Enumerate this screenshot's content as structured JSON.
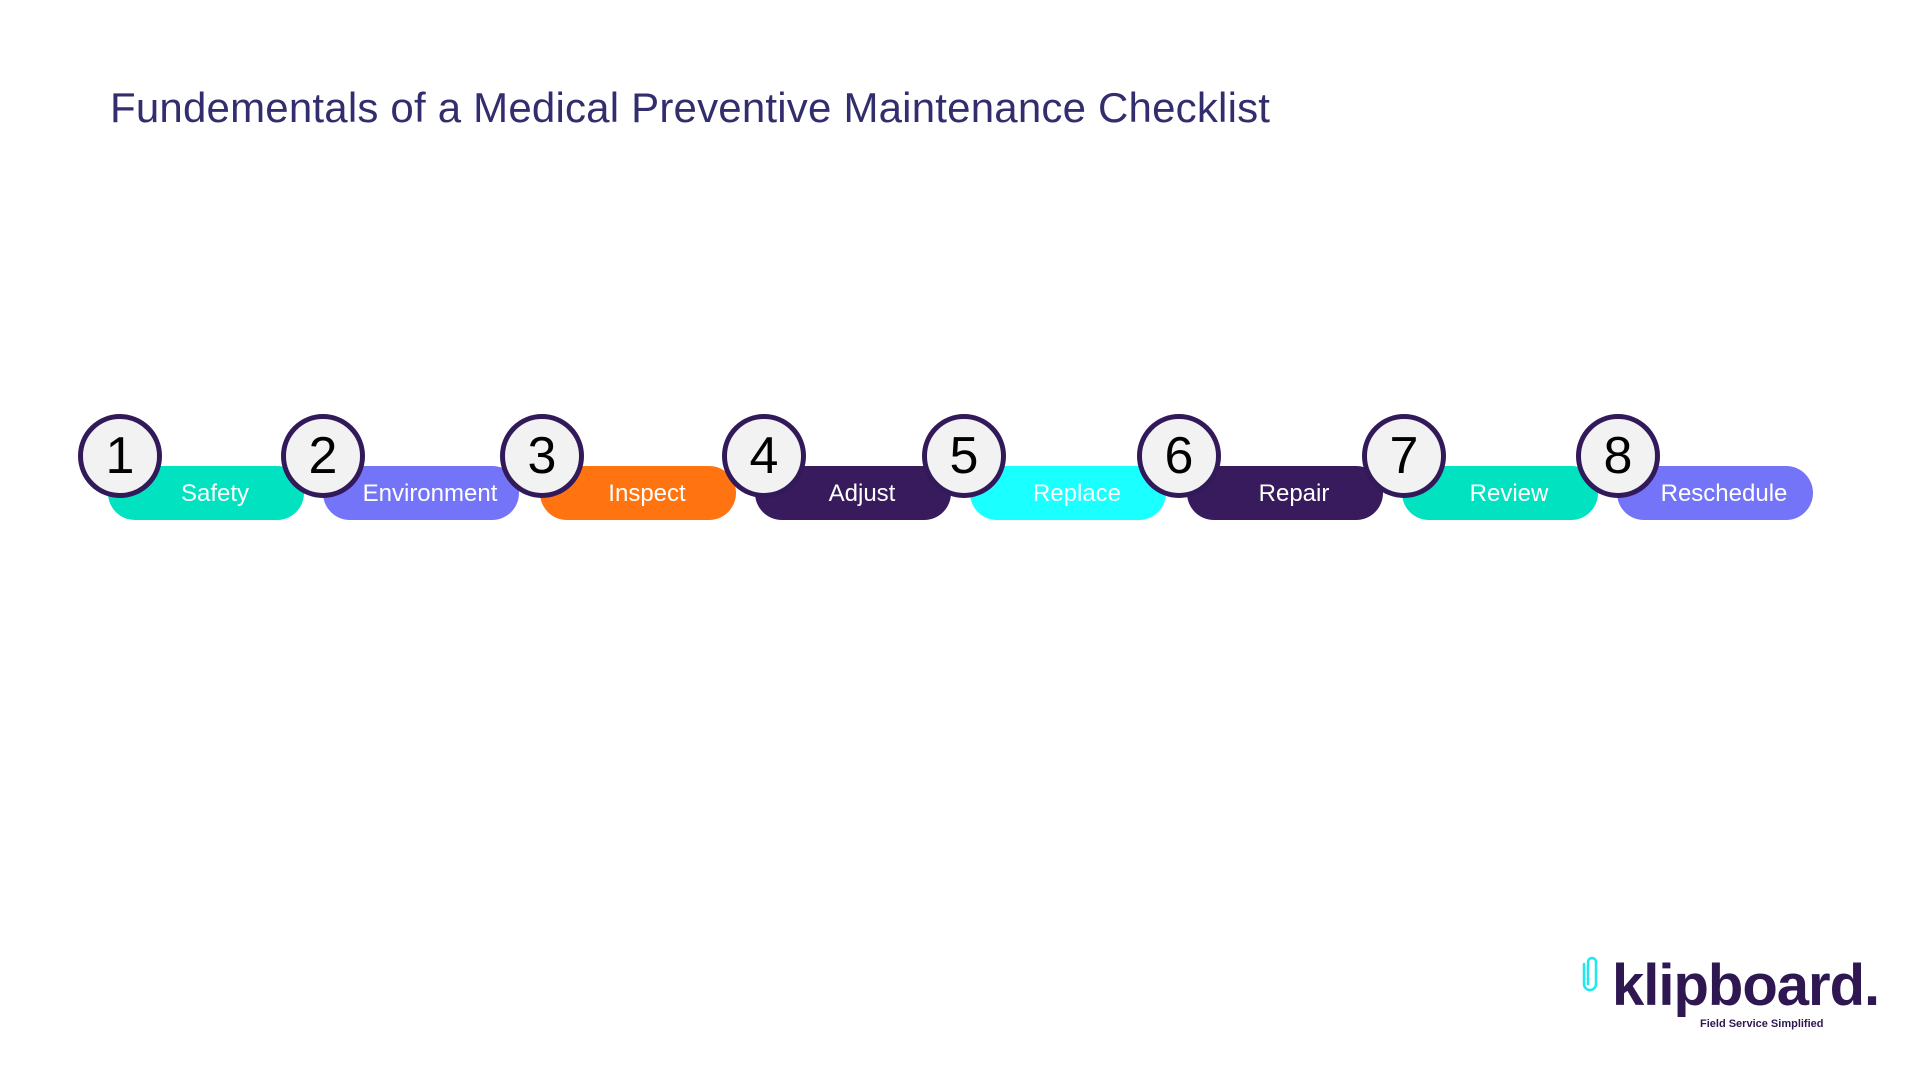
{
  "title": "Fundementals of a Medical Preventive Maintenance Checklist",
  "steps": [
    {
      "number": "1",
      "label": "Safety",
      "color": "#00e2c0"
    },
    {
      "number": "2",
      "label": "Environment",
      "color": "#7474f8"
    },
    {
      "number": "3",
      "label": "Inspect",
      "color": "#ff7410"
    },
    {
      "number": "4",
      "label": "Adjust",
      "color": "#371b5c"
    },
    {
      "number": "5",
      "label": "Replace",
      "color": "#1affff"
    },
    {
      "number": "6",
      "label": "Repair",
      "color": "#371b5c"
    },
    {
      "number": "7",
      "label": "Review",
      "color": "#00e2c0"
    },
    {
      "number": "8",
      "label": "Reschedule",
      "color": "#7474f8"
    }
  ],
  "logo": {
    "icon": "paperclip-icon",
    "brand": "klipboard.",
    "tagline": "Field Service Simplified",
    "icon_color": "#1be8f0",
    "brand_color": "#2f1852"
  },
  "colors": {
    "title": "#322e6e",
    "circle_border": "#321a5a",
    "circle_fill": "#f2f2f2"
  }
}
